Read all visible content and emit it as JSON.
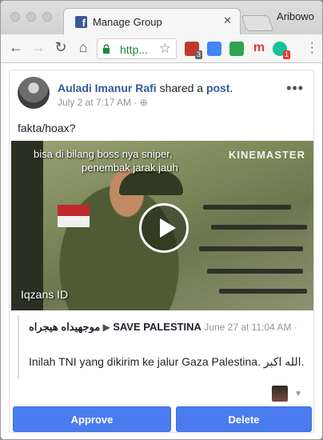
{
  "browser": {
    "tab_title": "Manage Group",
    "tab_close": "✕",
    "profile_name": "Aribowo",
    "url": "http...",
    "extensions": [
      {
        "name": "ublock-icon",
        "color": "#c0392b",
        "badge": "3",
        "badge_color": "#666666"
      },
      {
        "name": "google-translate-icon",
        "color": "#4285f4",
        "badge": "",
        "badge_color": ""
      },
      {
        "name": "download-icon",
        "color": "#2ea44f",
        "badge": "",
        "badge_color": ""
      },
      {
        "name": "m-extension-icon",
        "color": "#e53935",
        "badge": "",
        "badge_color": ""
      },
      {
        "name": "grammarly-icon",
        "color": "#15c39a",
        "badge": "1",
        "badge_color": "#e53935"
      }
    ]
  },
  "post": {
    "author": "Auladi Imanur Rafi",
    "shared_verb": "shared a",
    "shared_object": "post",
    "timestamp": "July 2 at 7:17 AM",
    "text": "fakta/hoax?",
    "options": "•••"
  },
  "video": {
    "overlay_text_1": "bisa di bilang boss nya sniper,",
    "overlay_text_2": "penembak jarak jauh",
    "brand": "KINEMASTER",
    "watermark": "Iqzans ID"
  },
  "shared_post": {
    "author": "موجهيداه هيجراه",
    "group": "SAVE PALESTINA",
    "timestamp": "June 27 at 11:04 AM",
    "text": "Inilah TNI yang dikirim ke jalur Gaza Palestina. الله اكبر."
  },
  "actions": {
    "approve": "Approve",
    "delete": "Delete"
  },
  "colors": {
    "facebook_blue": "#3b5998",
    "link_blue": "#365899",
    "button_blue": "#4a7cf0",
    "url_green": "#1a8b2f"
  }
}
